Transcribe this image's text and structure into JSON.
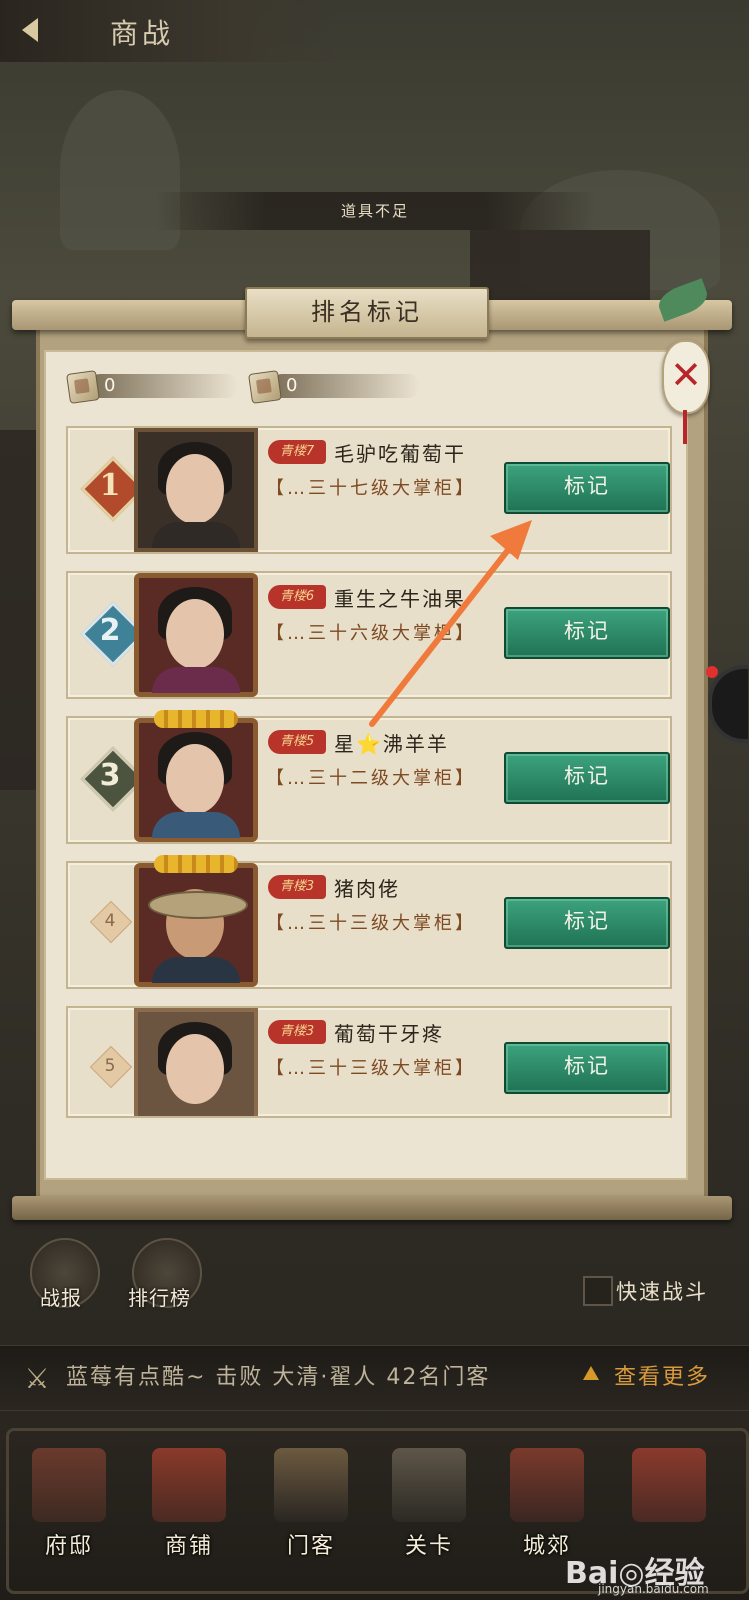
{
  "header": {
    "title": "商战"
  },
  "toast": "道具不足",
  "panel": {
    "title": "排名标记",
    "resources": [
      {
        "icon": "scroll-token-icon",
        "value": "0"
      },
      {
        "icon": "letter-token-icon",
        "value": "0"
      }
    ]
  },
  "players": [
    {
      "rank": "1",
      "badge": "青楼7",
      "name": "毛驴吃葡萄干",
      "title": "【…三十七级大掌柜】",
      "button": "标记"
    },
    {
      "rank": "2",
      "badge": "青楼6",
      "name": "重生之牛油果",
      "title": "【…三十六级大掌柜】",
      "button": "标记"
    },
    {
      "rank": "3",
      "badge": "青楼5",
      "name": "星⭐沸羊羊",
      "title": "【…三十二级大掌柜】",
      "button": "标记"
    },
    {
      "rank": "4",
      "badge": "青楼3",
      "name": "猪肉佬",
      "title": "【…三十三级大掌柜】",
      "button": "标记"
    },
    {
      "rank": "5",
      "badge": "青楼3",
      "name": "葡萄干牙疼",
      "title": "【…三十三级大掌柜】",
      "button": "标记"
    }
  ],
  "actions": {
    "battle_report": "战报",
    "leaderboard": "排行榜",
    "quick_battle": "快速战斗"
  },
  "ticker": {
    "text": "蓝莓有点酷~ 击败 大清·翟人 42名门客",
    "more": "查看更多"
  },
  "nav": [
    "府邸",
    "商铺",
    "门客",
    "关卡",
    "城郊",
    ""
  ],
  "watermark": {
    "main": "Bai◎经验",
    "sub": "jingyan.baidu.com"
  },
  "colors": {
    "button_green": "#2a8a66",
    "badge_red": "#b8342b",
    "title_brown": "#7e4a22"
  }
}
